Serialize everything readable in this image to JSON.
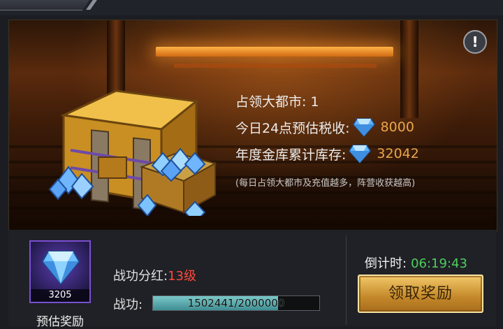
{
  "colors": {
    "accent_gold": "#e9a64b",
    "level_red": "#ff4a3a",
    "timer_green": "#4fcf5d",
    "progress_teal": "#5aa9ad"
  },
  "info_icon": "exclamation-icon",
  "treasury": {
    "cities_label": "占领大都市: 1",
    "tax_label": "今日24点预估税收:",
    "tax_value": "8000",
    "vault_label": "年度金库累计库存:",
    "vault_value": "32042",
    "note": "(每日占领大都市及充值越多，阵营收获越高)"
  },
  "reward_card": {
    "count": "3205",
    "label": "预估奖励"
  },
  "bonus": {
    "label": "战功分红:",
    "level": "13级"
  },
  "merit": {
    "label": "战功:",
    "progress_text": "1502441/2000000",
    "progress_fraction": 0.7512
  },
  "countdown": {
    "label": "倒计时:",
    "time": "06:19:43"
  },
  "claim_button": {
    "label": "领取奖励"
  }
}
